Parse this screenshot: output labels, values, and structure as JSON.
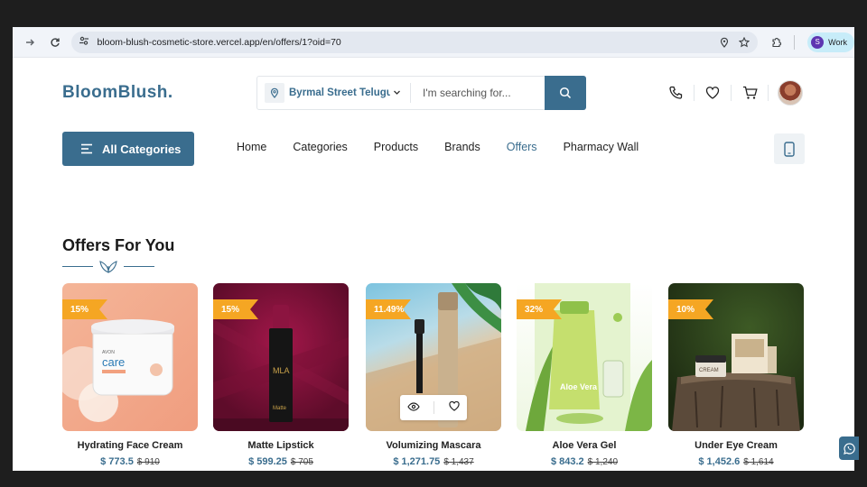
{
  "browser": {
    "url": "bloom-blush-cosmetic-store.vercel.app/en/offers/1?oid=70",
    "profile_initial": "S",
    "profile_label": "Work"
  },
  "header": {
    "logo": "BloomBlush.",
    "location": "Byrmal Street Telugu",
    "search_placeholder": "I'm searching for..."
  },
  "nav": {
    "all_categories": "All Categories",
    "items": [
      "Home",
      "Categories",
      "Products",
      "Brands",
      "Offers",
      "Pharmacy Wall"
    ],
    "active": "Offers"
  },
  "section": {
    "title": "Offers For You"
  },
  "products": [
    {
      "name": "Hydrating Face Cream",
      "discount": "15%",
      "price": "$ 773.5",
      "old_price": "$ 910"
    },
    {
      "name": "Matte Lipstick",
      "discount": "15%",
      "price": "$ 599.25",
      "old_price": "$ 705"
    },
    {
      "name": "Volumizing Mascara",
      "discount": "11.49%",
      "price": "$ 1,271.75",
      "old_price": "$ 1,437"
    },
    {
      "name": "Aloe Vera Gel",
      "discount": "32%",
      "price": "$ 843.2",
      "old_price": "$ 1,240"
    },
    {
      "name": "Under Eye Cream",
      "discount": "10%",
      "price": "$ 1,452.6",
      "old_price": "$ 1,614"
    }
  ],
  "product_image_labels": {
    "cream_brand": "care",
    "cream_top": "AVON",
    "lipstick_brand": "MLA",
    "lipstick_type": "Matte",
    "aloe_label": "Aloe Vera",
    "eye_cream_label": "CREAM"
  },
  "colors": {
    "accent": "#3a6d8e",
    "badge": "#f5a623"
  }
}
